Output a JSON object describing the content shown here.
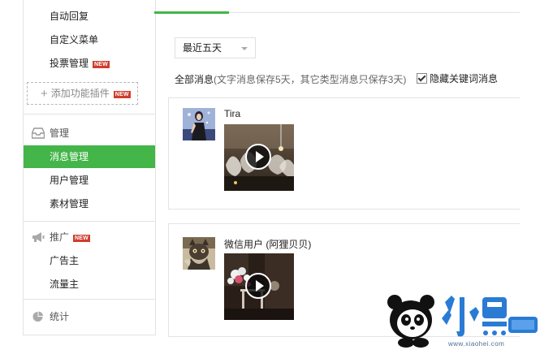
{
  "sidebar": {
    "items": [
      {
        "label": "自动回复"
      },
      {
        "label": "自定义菜单"
      },
      {
        "label": "投票管理",
        "badge": "NEW"
      }
    ],
    "add_plugin": {
      "label": "添加功能插件",
      "badge": "NEW",
      "icon": "plus-icon"
    },
    "manage_group": {
      "label": "管理",
      "icon": "inbox-icon"
    },
    "manage_items": [
      {
        "label": "消息管理",
        "active": true
      },
      {
        "label": "用户管理"
      },
      {
        "label": "素材管理"
      }
    ],
    "promote_group": {
      "label": "推广",
      "badge": "NEW",
      "icon": "megaphone-icon"
    },
    "promote_items": [
      {
        "label": "广告主"
      },
      {
        "label": "流量主"
      }
    ],
    "stats_group": {
      "label": "统计",
      "icon": "pie-chart-icon"
    }
  },
  "main": {
    "date_filter": {
      "selected": "最近五天"
    },
    "summary": {
      "all": "全部消息",
      "note": "(文字消息保存5天，其它类型消息只保存3天)"
    },
    "hide_keywords": {
      "label": "隐藏关键词消息",
      "checked": true
    },
    "messages": [
      {
        "nickname": "Tira",
        "type": "video"
      },
      {
        "nickname": "微信用户 (阿狸贝贝)",
        "type": "video"
      }
    ]
  },
  "colors": {
    "accent": "#44b549",
    "badge": "#d03d2e"
  },
  "watermark": {
    "brand": "小黑游戏",
    "url": "www.xiaohei.com"
  }
}
